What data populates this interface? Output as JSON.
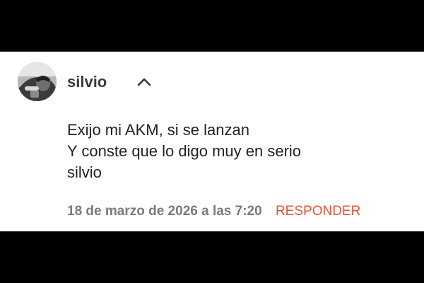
{
  "comment": {
    "author": "silvio",
    "avatar_icon": "user-photo-avatar",
    "collapse_icon": "chevron-up-icon",
    "lines": [
      "Exijo mi AKM, si se lanzan",
      "Y conste que lo digo muy en serio",
      "silvio"
    ],
    "timestamp": "18 de marzo de 2026 a las 7:20",
    "reply_label": "RESPONDER"
  },
  "colors": {
    "background": "#000000",
    "card": "#ffffff",
    "author": "#3a3a3a",
    "text": "#222222",
    "timestamp": "#7a7a7a",
    "accent": "#e2553a"
  }
}
